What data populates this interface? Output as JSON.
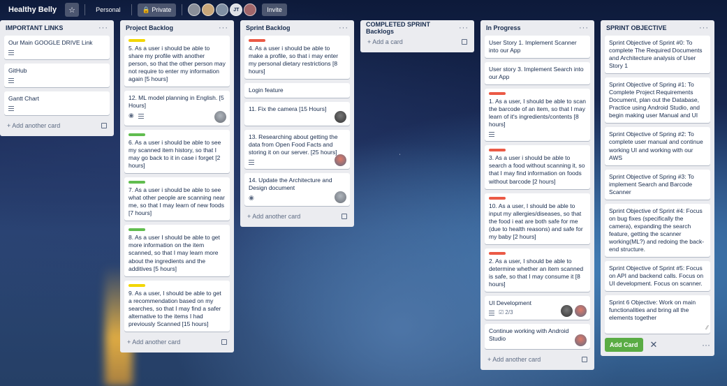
{
  "board": {
    "title": "Healthy Belly",
    "personal_label": "Personal",
    "visibility_label": "Private",
    "invite_label": "Invite",
    "member_initials": "JT"
  },
  "colors": {
    "green": "#61bd4f",
    "yellow": "#f2d600",
    "red": "#eb5a46"
  },
  "lists": [
    {
      "title": "IMPORTANT LINKS",
      "cards": [
        {
          "title": "Our Main GOOGLE DRIVE Link"
        },
        {
          "title": "GitHub"
        },
        {
          "title": "Gantt Chart"
        }
      ],
      "add_label": "Add another card"
    },
    {
      "title": "Project Backlog",
      "cards": [
        {
          "label": "yellow",
          "title": "5. As a user i should be able to share my profile with another person, so that the other person may not require to enter my information again [5 hours]"
        },
        {
          "title": "12. ML model planning in English. [5 Hours]"
        },
        {
          "label": "green",
          "title": "6. As a user i should be able to see my scanned item history, so that I may go back to it in case i forget [2 hours]"
        },
        {
          "label": "green",
          "title": "7. As a user i should be able to see what other people are scanning near me, so that I may learn of new foods [7 hours]"
        },
        {
          "label": "green",
          "title": "8. As a user I should be able to get more information on the item scanned, so that I may learn more about the ingredients and the additives [5 hours]"
        },
        {
          "label": "yellow",
          "title": "9. As a user, I should be able to get a recommendation based on my searches, so that I may find a safer alternative to the items I had previously Scanned [15 hours]"
        }
      ],
      "add_label": "Add another card"
    },
    {
      "title": "Sprint Backlog",
      "cards": [
        {
          "label": "red",
          "title": "4. As a user i should be able to make a profile, so that i may enter my personal dietary restrictions [8 hours]"
        },
        {
          "title": "Login feature"
        },
        {
          "title": "11. Fix the camera [15 Hours]"
        },
        {
          "title": "13. Researching about getting the data from Open Food Facts and storing it on our server. [25 hours]"
        },
        {
          "title": "14. Update the Architecture and Design document"
        }
      ],
      "add_label": "Add another card"
    },
    {
      "title": "COMPLETED SPRINT Backlogs",
      "cards": [],
      "add_label": "Add a card"
    },
    {
      "title": "In Progress",
      "cards": [
        {
          "title": "User Story 1. Implement Scanner into our App"
        },
        {
          "title": "User story 3. Implement Search into our App"
        },
        {
          "label": "red",
          "title": "1. As a user, I should be able to scan the barcode of an item, so that I may learn of it's ingredients/contents [8 hours]"
        },
        {
          "label": "red",
          "title": "3. As a user i should be able to search a food without scanning it, so that I may find information on foods without barcode [2 hours]"
        },
        {
          "label": "red",
          "title": "10. As a user, I should be able to input my allergies/diseases, so that the food i eat are both safe for me (due to health reasons) and safe for my baby [2 hours]"
        },
        {
          "label": "red",
          "title": "2. As a user, I should be able to determine whether an item scanned is safe, so that I may consume it [8 hours]"
        },
        {
          "title": "UI Development",
          "checklist": "2/3"
        },
        {
          "title": "Continue working with Android Studio"
        }
      ],
      "add_label": "Add another card"
    },
    {
      "title": "SPRINT OBJECTIVE",
      "cards": [
        {
          "title": "Sprint Objective of Sprint #0: To complete The Required Documents and Architecture analysis of User Story 1"
        },
        {
          "title": "Sprint Objective of Spring #1: To Complete Project Requirements Document, plan out the Database, Practice using Android Studio, and begin making user Manual and UI"
        },
        {
          "title": "Sprint Objective of Spring #2: To complete user manual and continue working UI and working with our AWS"
        },
        {
          "title": "Sprint Objective of Spring #3: To implement Search and Barcode Scanner"
        },
        {
          "title": "Sprint Objective of Sprint #4: Focus on bug fixes (specifically the camera), expanding the search feature, getting the scanner working(ML?) and redoing the back-end structure."
        },
        {
          "title": "Sprint Objective of Sprint #5: Focus on API and backend calls. Focus on UI development. Focus on scanner."
        }
      ],
      "composer_text": "Sprint 6 Objective: Work on main functionalities and bring all the elements together",
      "add_button_label": "Add Card"
    }
  ]
}
